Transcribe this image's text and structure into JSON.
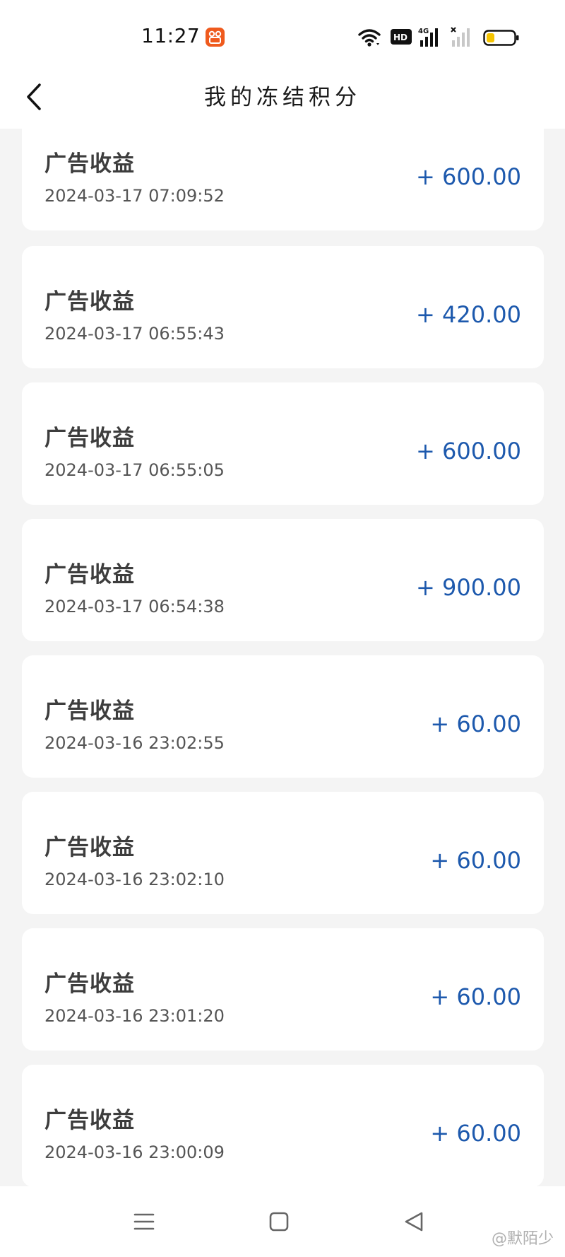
{
  "status_bar": {
    "time": "11:27",
    "app_badge_icon": "orange-app-icon",
    "icons": [
      "wifi-icon",
      "hd-voice-icon",
      "signal-4g-icon",
      "signal-no-service-icon",
      "battery-low-icon"
    ],
    "hd_label": "HD",
    "network_label": "4G",
    "battery_color": "#f5c400"
  },
  "header": {
    "title": "我的冻结积分",
    "back_icon": "chevron-left-icon"
  },
  "records": [
    {
      "title": "广告收益",
      "time": "2024-03-17 07:09:52",
      "amount": "+ 600.00"
    },
    {
      "title": "广告收益",
      "time": "2024-03-17 06:55:43",
      "amount": "+ 420.00"
    },
    {
      "title": "广告收益",
      "time": "2024-03-17 06:55:05",
      "amount": "+ 600.00"
    },
    {
      "title": "广告收益",
      "time": "2024-03-17 06:54:38",
      "amount": "+ 900.00"
    },
    {
      "title": "广告收益",
      "time": "2024-03-16 23:02:55",
      "amount": "+ 60.00"
    },
    {
      "title": "广告收益",
      "time": "2024-03-16 23:02:10",
      "amount": "+ 60.00"
    },
    {
      "title": "广告收益",
      "time": "2024-03-16 23:01:20",
      "amount": "+ 60.00"
    },
    {
      "title": "广告收益",
      "time": "2024-03-16 23:00:09",
      "amount": "+ 60.00"
    }
  ],
  "colors": {
    "amount": "#1d59ad",
    "background": "#f4f4f4",
    "card": "#ffffff"
  },
  "nav": {
    "icons": [
      "menu-icon",
      "home-square-icon",
      "back-triangle-icon"
    ]
  },
  "watermark": "@默陌少"
}
